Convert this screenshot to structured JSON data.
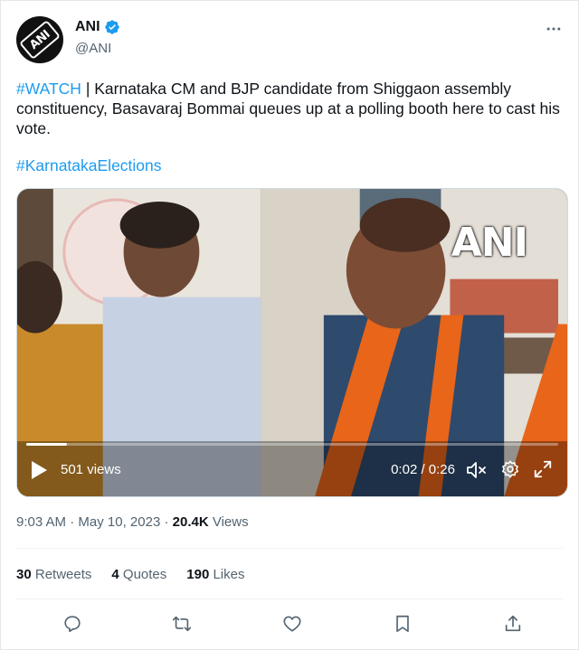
{
  "author": {
    "display_name": "ANI",
    "handle": "@ANI",
    "avatar_text": "ANI",
    "verified": true
  },
  "tweet": {
    "hashtag_watch": "#WATCH",
    "separator": " | ",
    "body": "Karnataka CM and BJP candidate from Shiggaon assembly constituency, Basavaraj Bommai queues up at a polling booth here to cast his vote.",
    "hashtag_elections": "#KarnatakaElections"
  },
  "video": {
    "watermark": "ANI",
    "views": "501 views",
    "time": "0:02 / 0:26",
    "progress": 0.077
  },
  "meta": {
    "time": "9:03 AM",
    "dot1": " · ",
    "date": "May 10, 2023",
    "dot2": " · ",
    "views_count": "20.4K",
    "views_label": " Views"
  },
  "stats": {
    "retweets_count": "30",
    "retweets_label": " Retweets",
    "quotes_count": "4",
    "quotes_label": " Quotes",
    "likes_count": "190",
    "likes_label": " Likes"
  },
  "icons": {
    "more": "more-icon",
    "verified": "verified-badge-icon",
    "play": "play-icon",
    "mute": "mute-icon",
    "settings": "gear-icon",
    "fullscreen": "fullscreen-icon",
    "reply": "reply-icon",
    "retweet": "retweet-icon",
    "like": "heart-icon",
    "bookmark": "bookmark-icon",
    "share": "share-icon"
  },
  "colors": {
    "link": "#1d9bf0",
    "secondary_text": "#536471",
    "primary_text": "#0f1419",
    "verified": "#1d9bf0"
  }
}
